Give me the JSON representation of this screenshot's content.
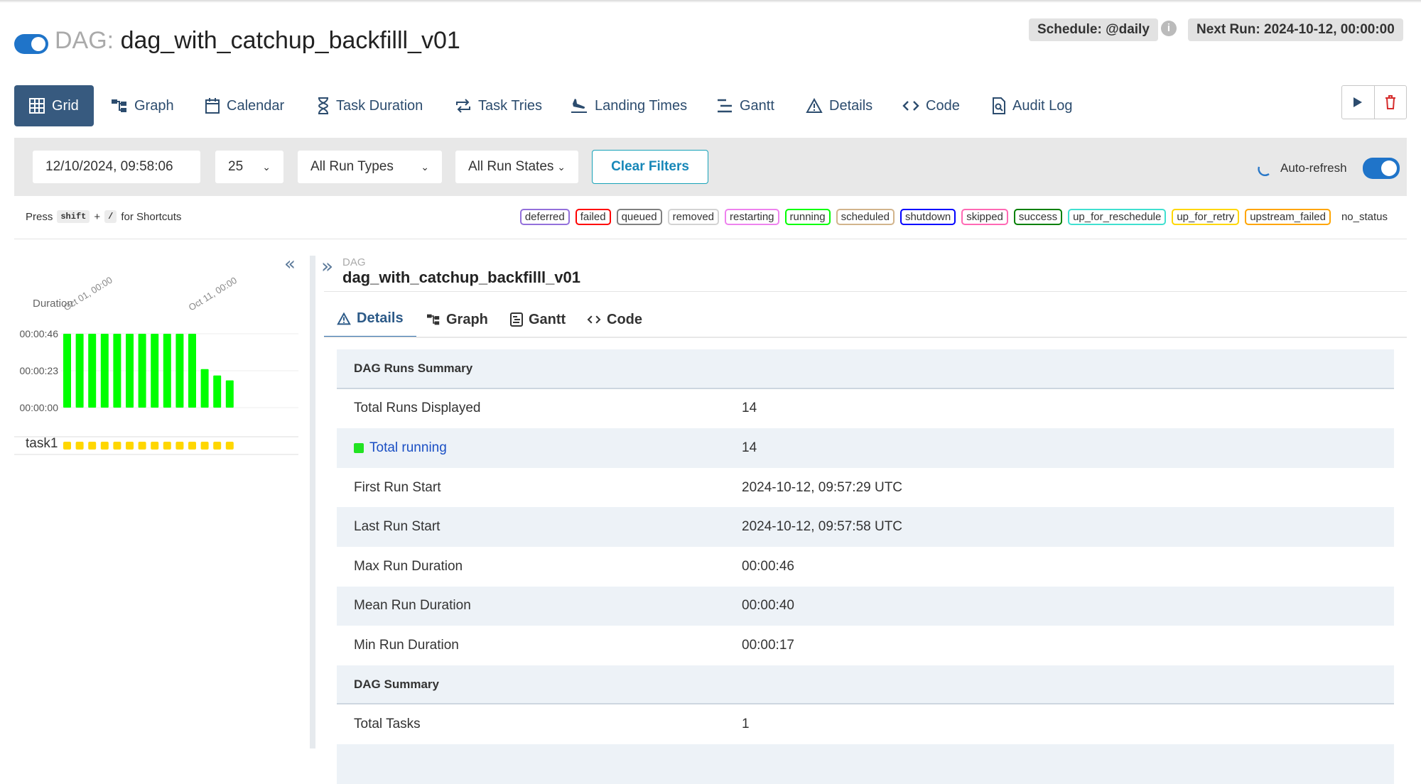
{
  "header": {
    "title_prefix": "DAG:",
    "dag_id": "dag_with_catchup_backfilll_v01",
    "schedule": "Schedule: @daily",
    "next_run": "Next Run: 2024-10-12, 00:00:00",
    "paused_toggle_on": true
  },
  "nav": [
    {
      "label": "Grid",
      "icon": "grid-icon",
      "active": true
    },
    {
      "label": "Graph",
      "icon": "graph-icon"
    },
    {
      "label": "Calendar",
      "icon": "calendar-icon"
    },
    {
      "label": "Task Duration",
      "icon": "hourglass-icon"
    },
    {
      "label": "Task Tries",
      "icon": "retry-icon"
    },
    {
      "label": "Landing Times",
      "icon": "landing-icon"
    },
    {
      "label": "Gantt",
      "icon": "gantt-icon"
    },
    {
      "label": "Details",
      "icon": "warning-triangle-icon"
    },
    {
      "label": "Code",
      "icon": "code-icon"
    },
    {
      "label": "Audit Log",
      "icon": "audit-log-icon"
    }
  ],
  "filters": {
    "base_date": "12/10/2024, 09:58:06",
    "num_runs": "25",
    "run_types": "All Run Types",
    "run_states": "All Run States",
    "clear_label": "Clear Filters",
    "auto_refresh_label": "Auto-refresh"
  },
  "shortcuts": {
    "press": "Press",
    "key1": "shift",
    "plus": "+",
    "key2": "/",
    "suffix": "for Shortcuts"
  },
  "legend": [
    {
      "label": "deferred",
      "color": "#9370db"
    },
    {
      "label": "failed",
      "color": "#ff0000"
    },
    {
      "label": "queued",
      "color": "#808080"
    },
    {
      "label": "removed",
      "color": "#d3d3d3"
    },
    {
      "label": "restarting",
      "color": "#ee82ee"
    },
    {
      "label": "running",
      "color": "#00ff00"
    },
    {
      "label": "scheduled",
      "color": "#d2b48c"
    },
    {
      "label": "shutdown",
      "color": "#0000ff"
    },
    {
      "label": "skipped",
      "color": "#ff69b4"
    },
    {
      "label": "success",
      "color": "#008000"
    },
    {
      "label": "up_for_reschedule",
      "color": "#40e0d0"
    },
    {
      "label": "up_for_retry",
      "color": "#ffd700"
    },
    {
      "label": "upstream_failed",
      "color": "#ffa500"
    },
    {
      "label": "no_status",
      "color": "none"
    }
  ],
  "grid": {
    "duration_label": "Duration",
    "y_ticks": [
      "00:00:46",
      "00:00:23",
      "00:00:00"
    ],
    "x_labels": [
      "Oct 01, 00:00",
      "Oct 11, 00:00"
    ],
    "task_label": "task1",
    "collapse_icon": "double-chevron-left-icon"
  },
  "chart_data": {
    "type": "bar",
    "title": "",
    "ylabel": "Duration",
    "xlabel": "",
    "unit": "seconds",
    "ylim": [
      0,
      46
    ],
    "categories": [
      "",
      "",
      "",
      "",
      "",
      "",
      "",
      "",
      "",
      "",
      "",
      "",
      "",
      ""
    ],
    "values": [
      46,
      46,
      46,
      46,
      46,
      46,
      46,
      46,
      46,
      46,
      46,
      24,
      20,
      17
    ],
    "bar_color": "#00ff00",
    "task_state_color": "#ffd700"
  },
  "details": {
    "expand_icon": "double-chevron-right-icon",
    "small_label": "DAG",
    "dag_id": "dag_with_catchup_backfilll_v01",
    "tabs": [
      {
        "label": "Details",
        "icon": "warning-triangle-icon",
        "active": true
      },
      {
        "label": "Graph",
        "icon": "graph-icon"
      },
      {
        "label": "Gantt",
        "icon": "gantt-icon"
      },
      {
        "label": "Code",
        "icon": "code-icon"
      }
    ],
    "rows": [
      {
        "type": "head",
        "key": "DAG Runs Summary",
        "value": ""
      },
      {
        "key": "Total Runs Displayed",
        "value": "14"
      },
      {
        "key": "Total running",
        "value": "14",
        "link": true
      },
      {
        "key": "First Run Start",
        "value": "2024-10-12, 09:57:29 UTC"
      },
      {
        "key": "Last Run Start",
        "value": "2024-10-12, 09:57:58 UTC"
      },
      {
        "key": "Max Run Duration",
        "value": "00:00:46"
      },
      {
        "key": "Mean Run Duration",
        "value": "00:00:40"
      },
      {
        "key": "Min Run Duration",
        "value": "00:00:17"
      },
      {
        "type": "head",
        "key": "DAG Summary",
        "value": ""
      },
      {
        "key": "Total Tasks",
        "value": "1"
      },
      {
        "key": "",
        "value": ""
      }
    ]
  }
}
